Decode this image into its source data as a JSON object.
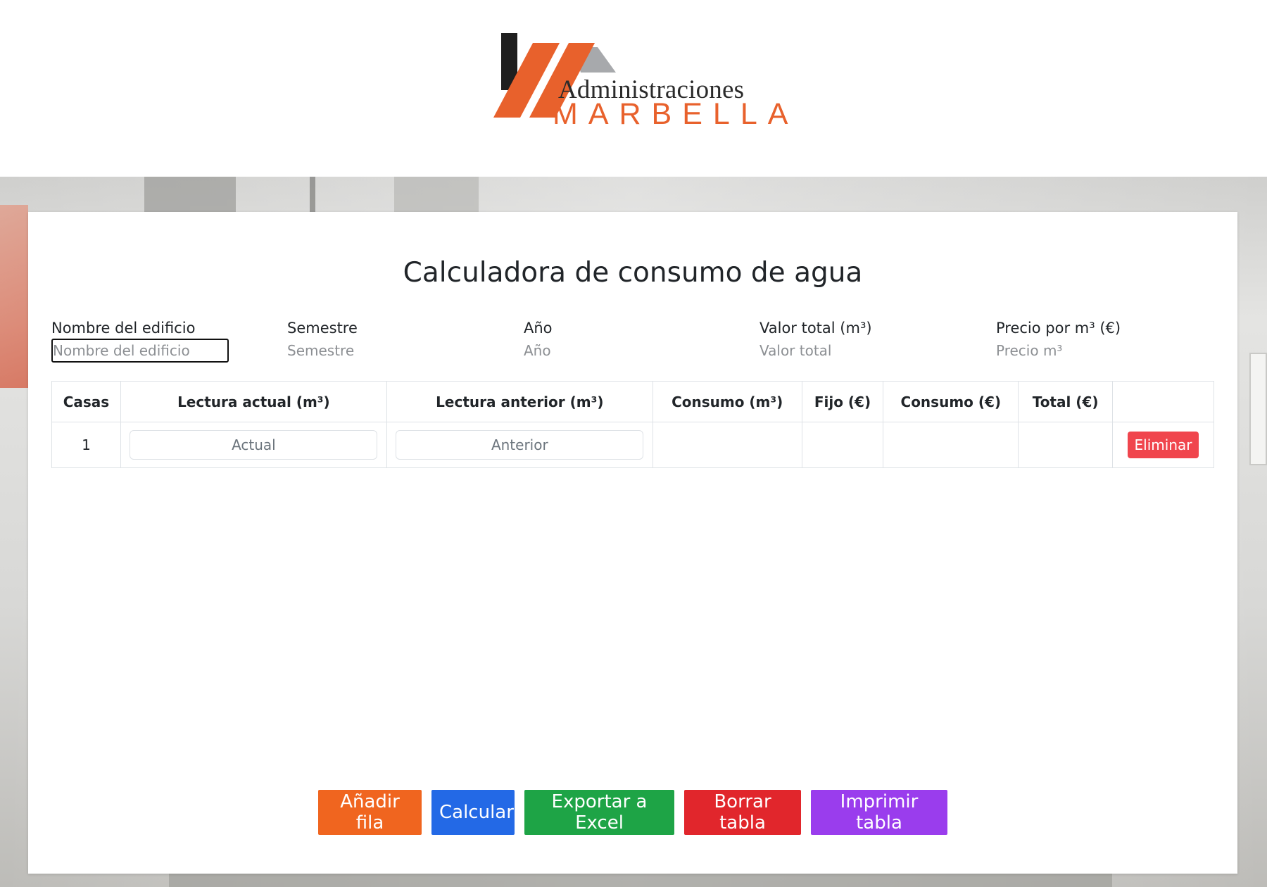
{
  "logo": {
    "line1": "Administraciones",
    "line2": "MARBELLA",
    "colors": {
      "orange": "#e8612c",
      "dark": "#1f1f1f",
      "gray": "#a7a9ac"
    }
  },
  "page": {
    "title": "Calculadora de consumo de agua"
  },
  "form": {
    "fields": [
      {
        "label": "Nombre del edificio",
        "placeholder": "Nombre del edificio",
        "value": ""
      },
      {
        "label": "Semestre",
        "placeholder": "Semestre",
        "value": ""
      },
      {
        "label": "Año",
        "placeholder": "Año",
        "value": ""
      },
      {
        "label": "Valor total (m³)",
        "placeholder": "Valor total",
        "value": ""
      },
      {
        "label": "Precio por m³ (€)",
        "placeholder": "Precio m³",
        "value": ""
      }
    ]
  },
  "table": {
    "headers": [
      "Casas",
      "Lectura actual (m³)",
      "Lectura anterior (m³)",
      "Consumo (m³)",
      "Fijo (€)",
      "Consumo (€)",
      "Total (€)",
      ""
    ],
    "rows": [
      {
        "casa": "1",
        "actual_placeholder": "Actual",
        "anterior_placeholder": "Anterior",
        "consumo_m3": "",
        "fijo": "",
        "consumo_eur": "",
        "total": "",
        "delete_label": "Eliminar"
      }
    ]
  },
  "actions": {
    "add": "Añadir fila",
    "calc": "Calcular",
    "export": "Exportar a Excel",
    "clear": "Borrar tabla",
    "print": "Imprimir tabla"
  },
  "colors": {
    "add": "#f0651f",
    "calc": "#2369e6",
    "export": "#1ea446",
    "clear": "#e1262c",
    "print": "#9a3ded",
    "delete": "#f0454d"
  }
}
